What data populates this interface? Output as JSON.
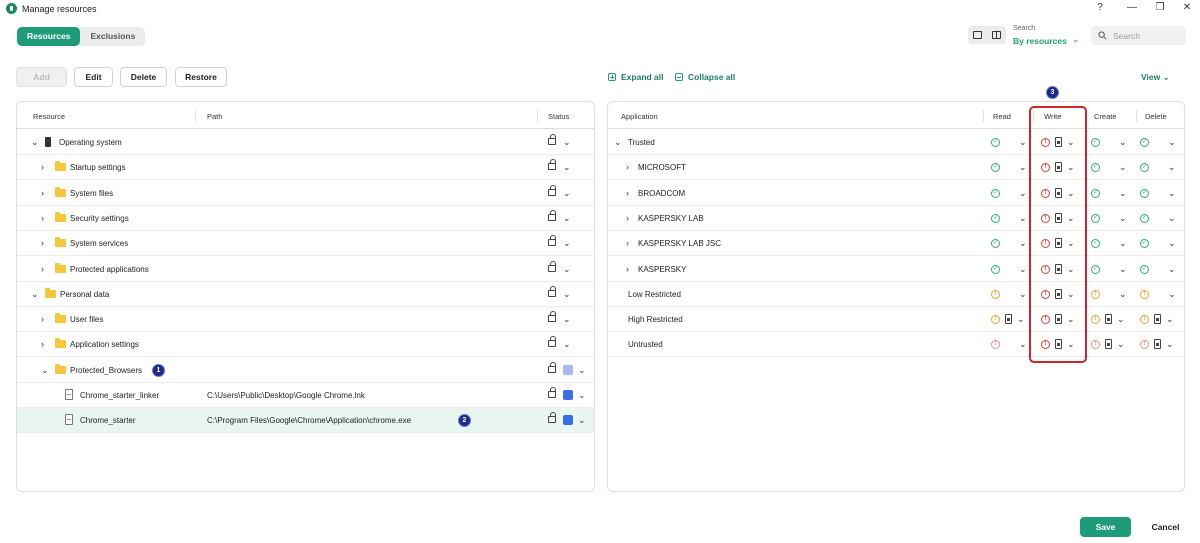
{
  "window": {
    "title": "Manage resources",
    "help": "?",
    "minimize": "—",
    "maximize": "❐",
    "close": "✕"
  },
  "tabs": [
    {
      "label": "Resources",
      "active": true
    },
    {
      "label": "Exclusions",
      "active": false
    }
  ],
  "search": {
    "caption": "Search",
    "mode": "By resources",
    "placeholder": "Search"
  },
  "toolbar": {
    "add": "Add",
    "edit": "Edit",
    "delete": "Delete",
    "restore": "Restore"
  },
  "right_toolbar": {
    "expand_all": "Expand all",
    "collapse_all": "Collapse all",
    "view": "View"
  },
  "resources": {
    "columns": {
      "resource": "Resource",
      "path": "Path",
      "status": "Status"
    },
    "rows": [
      {
        "name": "Operating system",
        "path": "",
        "level": 0,
        "expanded": true,
        "icon": "os-icon"
      },
      {
        "name": "Startup settings",
        "path": "",
        "level": 1,
        "expanded": false,
        "icon": "folder-icon"
      },
      {
        "name": "System files",
        "path": "",
        "level": 1,
        "expanded": false,
        "icon": "folder-icon"
      },
      {
        "name": "Security settings",
        "path": "",
        "level": 1,
        "expanded": false,
        "icon": "folder-icon"
      },
      {
        "name": "System services",
        "path": "",
        "level": 1,
        "expanded": false,
        "icon": "folder-icon"
      },
      {
        "name": "Protected applications",
        "path": "",
        "level": 1,
        "expanded": false,
        "icon": "folder-icon"
      },
      {
        "name": "Personal data",
        "path": "",
        "level": 0,
        "expanded": true,
        "icon": "folder-icon"
      },
      {
        "name": "User files",
        "path": "",
        "level": 1,
        "expanded": false,
        "icon": "folder-icon"
      },
      {
        "name": "Application settings",
        "path": "",
        "level": 1,
        "expanded": false,
        "icon": "folder-icon"
      },
      {
        "name": "Protected_Browsers",
        "path": "",
        "level": 1,
        "expanded": true,
        "icon": "folder-icon",
        "badge": "1",
        "color": "#a9b8ee"
      },
      {
        "name": "Chrome_starter_linker",
        "path": "C:\\Users\\Public\\Desktop\\Google Chrome.lnk",
        "level": 2,
        "icon": "file-icon",
        "color": "#3a6ee8"
      },
      {
        "name": "Chrome_starter",
        "path": "C:\\Program Files\\Google\\Chrome\\Application\\chrome.exe",
        "level": 2,
        "icon": "file-icon",
        "color": "#3a6ee8",
        "selected": true,
        "badge": "2"
      }
    ]
  },
  "applications": {
    "columns": {
      "application": "Application",
      "read": "Read",
      "write": "Write",
      "create": "Create",
      "delete": "Delete"
    },
    "highlight_badge": "3",
    "rows": [
      {
        "name": "Trusted",
        "level": 0,
        "expanded": true,
        "perms": [
          "allow",
          "block",
          "allow",
          "allow"
        ]
      },
      {
        "name": "MICROSOFT",
        "level": 1,
        "expanded": false,
        "perms": [
          "allow",
          "block",
          "allow",
          "allow"
        ]
      },
      {
        "name": "BROADCOM",
        "level": 1,
        "expanded": false,
        "perms": [
          "allow",
          "block",
          "allow",
          "allow"
        ]
      },
      {
        "name": "KASPERSKY LAB",
        "level": 1,
        "expanded": false,
        "perms": [
          "allow",
          "block",
          "allow",
          "allow"
        ]
      },
      {
        "name": "KASPERSKY LAB JSC",
        "level": 1,
        "expanded": false,
        "perms": [
          "allow",
          "block",
          "allow",
          "allow"
        ]
      },
      {
        "name": "KASPERSKY",
        "level": 1,
        "expanded": false,
        "perms": [
          "allow",
          "block",
          "allow",
          "allow"
        ]
      },
      {
        "name": "Low Restricted",
        "level": 0,
        "perms": [
          "warn",
          "block",
          "warn",
          "warn"
        ]
      },
      {
        "name": "High Restricted",
        "level": 0,
        "perms": [
          "warn",
          "block",
          "warn",
          "warn"
        ]
      },
      {
        "name": "Untrusted",
        "level": 0,
        "perms": [
          "block-light",
          "block",
          "block-light",
          "block-light"
        ]
      }
    ]
  },
  "footer": {
    "save": "Save",
    "cancel": "Cancel"
  },
  "colors": {
    "accent": "#1e9b78",
    "highlight": "#d0262a",
    "allow": "#2cae7d",
    "warn": "#e8a52c",
    "block": "#e53935"
  }
}
